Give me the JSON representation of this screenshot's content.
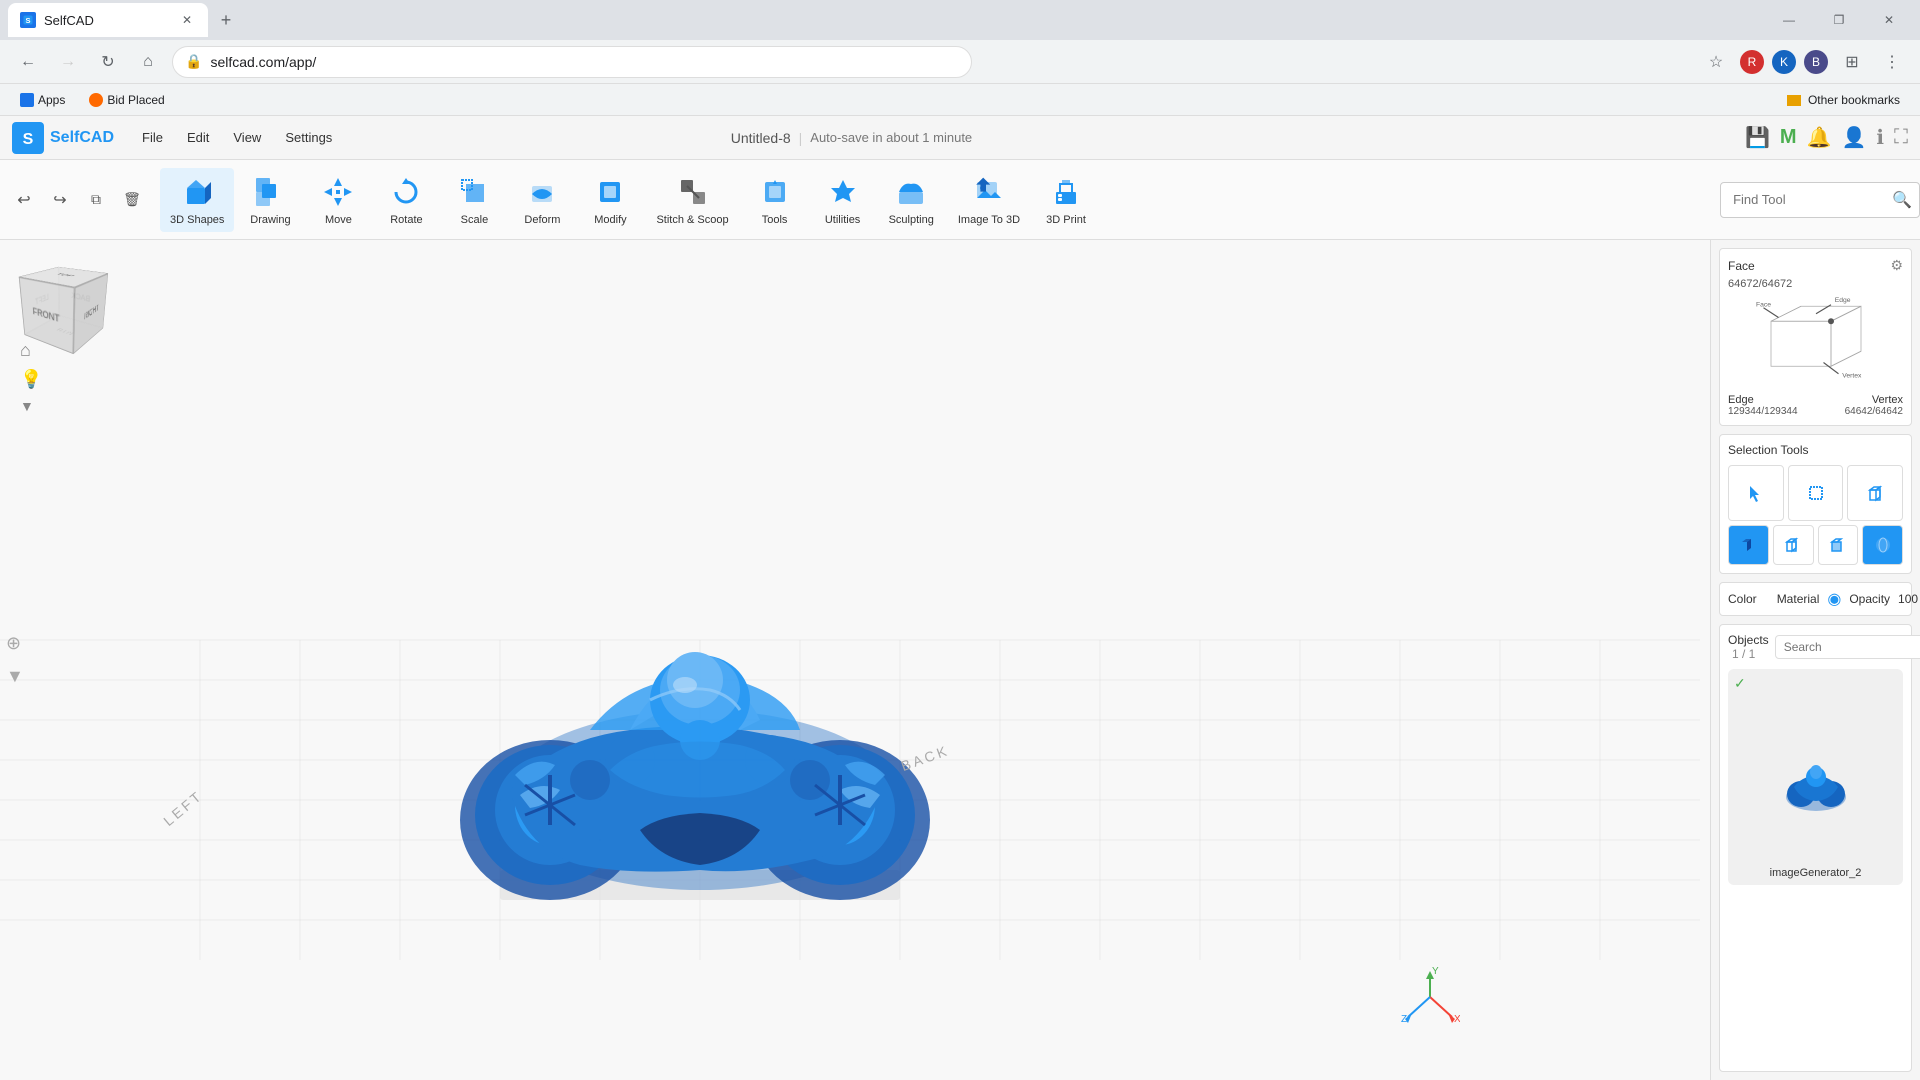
{
  "browser": {
    "tab_title": "SelfCAD",
    "url": "selfcad.com/app/",
    "new_tab_label": "+",
    "bookmarks": [
      {
        "label": "Apps",
        "icon_color": "#1a73e8"
      },
      {
        "label": "Bid Placed",
        "icon_color": "#ff6900"
      }
    ],
    "other_bookmarks": "Other bookmarks",
    "window_controls": [
      "—",
      "❐",
      "✕"
    ]
  },
  "app": {
    "logo_text": "SelfCAD",
    "menu_items": [
      "File",
      "Edit",
      "View",
      "Settings"
    ],
    "doc_title": "Untitled-8",
    "autosave_text": "Auto-save in about 1 minute",
    "toolbar": [
      {
        "label": "3D Shapes",
        "has_arrow": true
      },
      {
        "label": "Drawing",
        "has_arrow": true
      },
      {
        "label": "Move",
        "has_arrow": false
      },
      {
        "label": "Rotate",
        "has_arrow": false
      },
      {
        "label": "Scale",
        "has_arrow": false
      },
      {
        "label": "Deform",
        "has_arrow": true
      },
      {
        "label": "Modify",
        "has_arrow": true
      },
      {
        "label": "Stitch & Scoop",
        "has_arrow": false
      },
      {
        "label": "Tools",
        "has_arrow": true
      },
      {
        "label": "Utilities",
        "has_arrow": true
      },
      {
        "label": "Sculpting",
        "has_arrow": false
      },
      {
        "label": "Image To 3D",
        "has_arrow": false
      },
      {
        "label": "3D Print",
        "has_arrow": false
      }
    ],
    "find_tool_placeholder": "Find Tool",
    "right_panel": {
      "face_label": "Face",
      "face_count": "64672/64672",
      "edge_label": "Edge",
      "edge_count": "129344/129344",
      "vertex_label": "Vertex",
      "vertex_count": "64642/64642",
      "selection_tools_label": "Selection Tools",
      "color_label": "Color",
      "material_label": "Material",
      "opacity_label": "Opacity",
      "opacity_value": "100",
      "objects_title": "Objects",
      "objects_count": "1 / 1",
      "objects_search_placeholder": "Search",
      "object_name": "imageGenerator_2"
    },
    "viewport_labels": {
      "left_label": "LEFT",
      "back_label": "BACK"
    }
  }
}
